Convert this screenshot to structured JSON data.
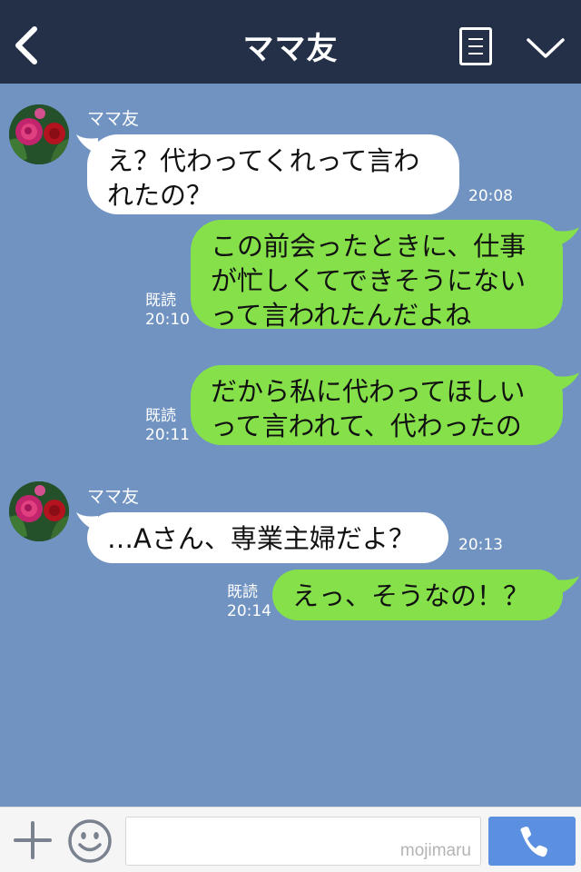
{
  "header": {
    "title": "ママ友",
    "back_icon": "chevron-left-icon",
    "menu_icon": "list-menu-icon",
    "collapse_icon": "chevron-down-icon"
  },
  "messages": [
    {
      "direction": "incoming",
      "sender": "ママ友",
      "lines": [
        "え？代わってくれって言わ",
        "れたの？"
      ],
      "time": "20:08"
    },
    {
      "direction": "outgoing",
      "lines": [
        "この前会ったときに、仕事",
        "が忙しくてできそうにない",
        "って言われたんだよね"
      ],
      "read": "既読",
      "time": "20:10"
    },
    {
      "direction": "outgoing",
      "lines": [
        "だから私に代わってほしい",
        "って言われて、代わったの"
      ],
      "read": "既読",
      "time": "20:11"
    },
    {
      "direction": "incoming",
      "sender": "ママ友",
      "lines": [
        "…Aさん、専業主婦だよ？"
      ],
      "time": "20:13"
    },
    {
      "direction": "outgoing",
      "lines": [
        "えっ、そうなの！？"
      ],
      "read": "既読",
      "time": "20:14"
    }
  ],
  "footer": {
    "watermark": "mojimaru",
    "add_icon": "plus-icon",
    "emoji_icon": "smiley-icon",
    "call_icon": "phone-icon"
  },
  "colors": {
    "header_bg": "#243048",
    "chat_bg": "#7193c2",
    "incoming_bubble": "#ffffff",
    "outgoing_bubble": "#85e04a",
    "call_button": "#5b8fe0"
  }
}
